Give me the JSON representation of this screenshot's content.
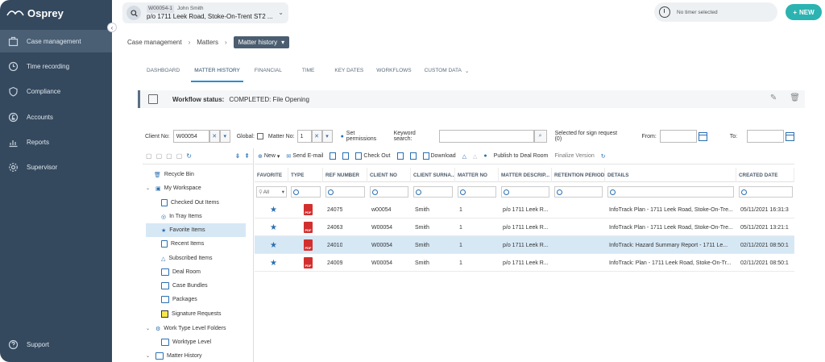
{
  "app": {
    "logo": "Osprey",
    "colors": {
      "sidebar": "#34495e",
      "accent": "#2bb3b1",
      "primary": "#2a6fb0"
    }
  },
  "sidebar": {
    "items": [
      {
        "label": "Case management",
        "icon": "briefcase-icon"
      },
      {
        "label": "Time recording",
        "icon": "clock-icon"
      },
      {
        "label": "Compliance",
        "icon": "shield-icon"
      },
      {
        "label": "Accounts",
        "icon": "pound-icon"
      },
      {
        "label": "Reports",
        "icon": "chart-icon"
      },
      {
        "label": "Supervisor",
        "icon": "gear-icon"
      }
    ],
    "support": "Support"
  },
  "header": {
    "matter_id": "W00054-1",
    "client_name": "John Smith",
    "matter_address": "p/o 1711 Leek Road, Stoke-On-Trent ST2 ...",
    "timer_text": "No timer selected",
    "new_label": "NEW"
  },
  "breadcrumb": {
    "items": [
      "Case management",
      "Matters"
    ],
    "current": "Matter history"
  },
  "tabs": [
    "DASHBOARD",
    "MATTER HISTORY",
    "FINANCIAL",
    "TIME",
    "KEY DATES",
    "WORKFLOWS",
    "CUSTOM DATA"
  ],
  "workflow": {
    "label": "Workflow status:",
    "value": "COMPLETED: File Opening"
  },
  "filters": {
    "client_no_label": "Client No:",
    "client_no_value": "W00054",
    "global_label": "Global:",
    "matter_no_label": "Matter No:",
    "matter_no_value": "1",
    "set_permissions": "Set permissions",
    "keyword_label": "Keyword search:",
    "selected_label": "Selected for sign request (0)",
    "from_label": "From:",
    "to_label": "To:"
  },
  "tree": {
    "recycle_bin": "Recycle Bin",
    "my_workspace": "My Workspace",
    "workspace_items": [
      "Checked Out Items",
      "In Tray Items",
      "Favorite Items",
      "Recent Items",
      "Subscribed Items",
      "Deal Room",
      "Case Bundles",
      "Packages",
      "Signature Requests"
    ],
    "work_type_folders": "Work Type Level Folders",
    "worktype_level": "Worktype Level",
    "matter_history": "Matter History"
  },
  "grid_toolbar": {
    "new": "New",
    "send_email": "Send E-mail",
    "check_out": "Check Out",
    "download": "Download",
    "publish": "Publish to Deal Room",
    "finalize": "Finalize Version"
  },
  "grid": {
    "columns": [
      "FAVORITE",
      "TYPE",
      "REF NUMBER",
      "CLIENT NO",
      "CLIENT SURNA...",
      "MATTER NO",
      "MATTER DESCRIP...",
      "RETENTION PERIOD",
      "DETAILS",
      "CREATED DATE"
    ],
    "filter_all": "All",
    "rows": [
      {
        "ref": "24075",
        "client_no": "w00054",
        "surname": "Smith",
        "matter_no": "1",
        "desc": "p/o 1711 Leek R...",
        "retention": "",
        "details": "InfoTrack Plan - 1711 Leek Road, Stoke-On-Tre...",
        "created": "05/11/2021 16:31:3"
      },
      {
        "ref": "24063",
        "client_no": "W00054",
        "surname": "Smith",
        "matter_no": "1",
        "desc": "p/o 1711 Leek R...",
        "retention": "",
        "details": "InfoTrack Plan - 1711 Leek Road, Stoke-On-Tre...",
        "created": "05/11/2021 13:21:1"
      },
      {
        "ref": "24010",
        "client_no": "W00054",
        "surname": "Smith",
        "matter_no": "1",
        "desc": "p/o 1711 Leek R...",
        "retention": "",
        "details": "InfoTrack: Hazard Summary Report - 1711 Le...",
        "created": "02/11/2021 08:50:1"
      },
      {
        "ref": "24009",
        "client_no": "W00054",
        "surname": "Smith",
        "matter_no": "1",
        "desc": "p/o 1711 Leek R...",
        "retention": "",
        "details": "InfoTrack: Plan - 1711 Leek Road, Stoke-On-Tr...",
        "created": "02/11/2021 08:50:1"
      }
    ]
  }
}
